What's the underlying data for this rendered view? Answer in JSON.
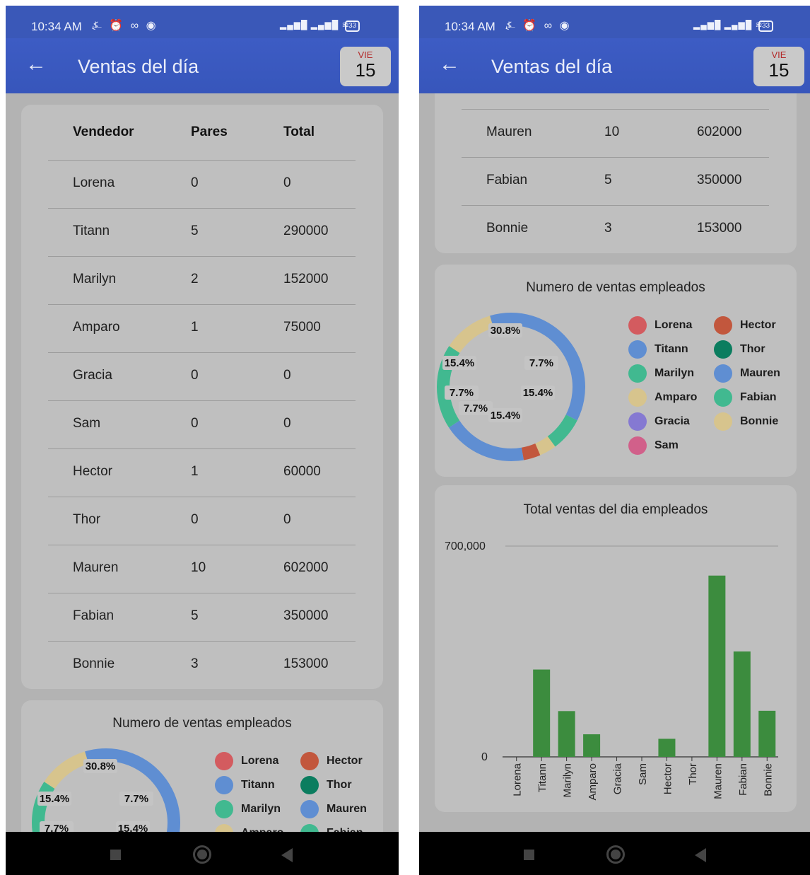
{
  "status_bar": {
    "time": "10:34 AM",
    "icons": "⍼ ⏰ ∞ ◉",
    "signal": "▂▄▆█ ▂▄▆█ ≋",
    "battery": "33"
  },
  "header": {
    "title": "Ventas del día",
    "back_icon": "arrow-left-icon",
    "date_weekday": "VIE",
    "date_day": "15"
  },
  "table": {
    "columns": [
      "Vendedor",
      "Pares",
      "Total"
    ],
    "rows": [
      {
        "name": "Lorena",
        "pares": "0",
        "total": "0"
      },
      {
        "name": "Titann",
        "pares": "5",
        "total": "290000"
      },
      {
        "name": "Marilyn",
        "pares": "2",
        "total": "152000"
      },
      {
        "name": "Amparo",
        "pares": "1",
        "total": "75000"
      },
      {
        "name": "Gracia",
        "pares": "0",
        "total": "0"
      },
      {
        "name": "Sam",
        "pares": "0",
        "total": "0"
      },
      {
        "name": "Hector",
        "pares": "1",
        "total": "60000"
      },
      {
        "name": "Thor",
        "pares": "0",
        "total": "0"
      },
      {
        "name": "Mauren",
        "pares": "10",
        "total": "602000"
      },
      {
        "name": "Fabian",
        "pares": "5",
        "total": "350000"
      },
      {
        "name": "Bonnie",
        "pares": "3",
        "total": "153000"
      }
    ]
  },
  "pie_colors": {
    "Lorena": "#d35b5f",
    "Titann": "#5f8ed2",
    "Marilyn": "#41b990",
    "Amparo": "#d7c48d",
    "Gracia": "#8579d2",
    "Sam": "#d1608a",
    "Hector": "#c2573d",
    "Thor": "#0b7d5f",
    "Mauren": "#5f8ed2",
    "Fabian": "#41b990",
    "Bonnie": "#d7c48d"
  },
  "bar_color": "#3c8c3e",
  "chart_data": [
    {
      "type": "pie",
      "title": "Numero de ventas empleados",
      "categories": [
        "Lorena",
        "Titann",
        "Marilyn",
        "Amparo",
        "Gracia",
        "Sam",
        "Hector",
        "Thor",
        "Mauren",
        "Fabian",
        "Bonnie"
      ],
      "values": [
        0,
        5,
        2,
        1,
        0,
        0,
        1,
        0,
        10,
        5,
        3
      ],
      "slice_labels": [
        "30.8%",
        "7.7%",
        "15.4%",
        "15.4%",
        "7.7%",
        "7.7%",
        "15.4%"
      ],
      "legend": "right"
    },
    {
      "type": "bar",
      "title": "Total ventas del dia empleados",
      "categories": [
        "Lorena",
        "Titann",
        "Marilyn",
        "Amparo",
        "Gracia",
        "Sam",
        "Hector",
        "Thor",
        "Mauren",
        "Fabian",
        "Bonnie"
      ],
      "values": [
        0,
        290000,
        152000,
        75000,
        0,
        0,
        60000,
        0,
        602000,
        350000,
        153000
      ],
      "ylim": [
        0,
        700000
      ],
      "yticks": [
        "700,000",
        "0"
      ],
      "grid": true
    }
  ]
}
